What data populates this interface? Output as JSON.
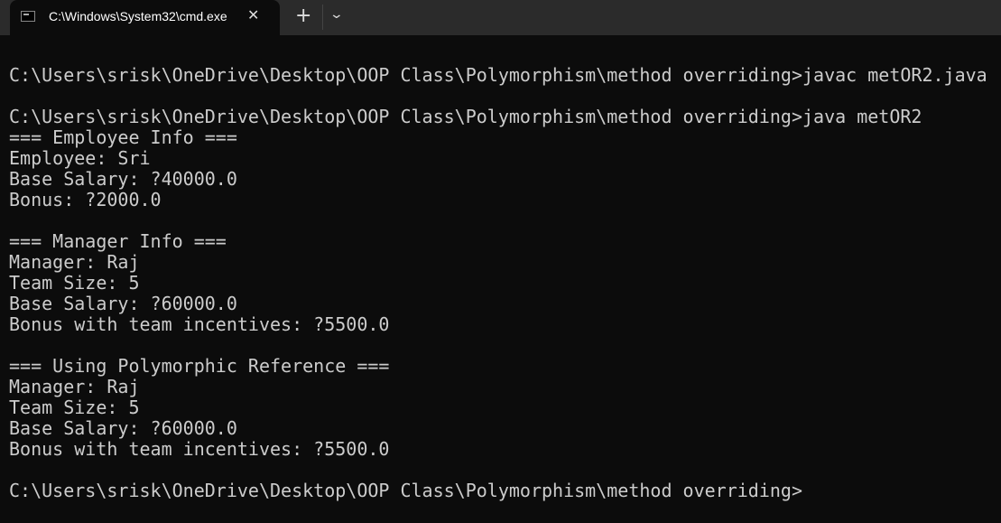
{
  "tab": {
    "title": "C:\\Windows\\System32\\cmd.exe",
    "close_icon": "close-icon",
    "new_tab_icon": "plus-icon",
    "dropdown_icon": "chevron-down-icon"
  },
  "terminal": {
    "lines": [
      "",
      "C:\\Users\\srisk\\OneDrive\\Desktop\\OOP Class\\Polymorphism\\method overriding>javac metOR2.java",
      "",
      "C:\\Users\\srisk\\OneDrive\\Desktop\\OOP Class\\Polymorphism\\method overriding>java metOR2",
      "=== Employee Info ===",
      "Employee: Sri",
      "Base Salary: ?40000.0",
      "Bonus: ?2000.0",
      "",
      "=== Manager Info ===",
      "Manager: Raj",
      "Team Size: 5",
      "Base Salary: ?60000.0",
      "Bonus with team incentives: ?5500.0",
      "",
      "=== Using Polymorphic Reference ===",
      "Manager: Raj",
      "Team Size: 5",
      "Base Salary: ?60000.0",
      "Bonus with team incentives: ?5500.0",
      "",
      "C:\\Users\\srisk\\OneDrive\\Desktop\\OOP Class\\Polymorphism\\method overriding>"
    ]
  }
}
